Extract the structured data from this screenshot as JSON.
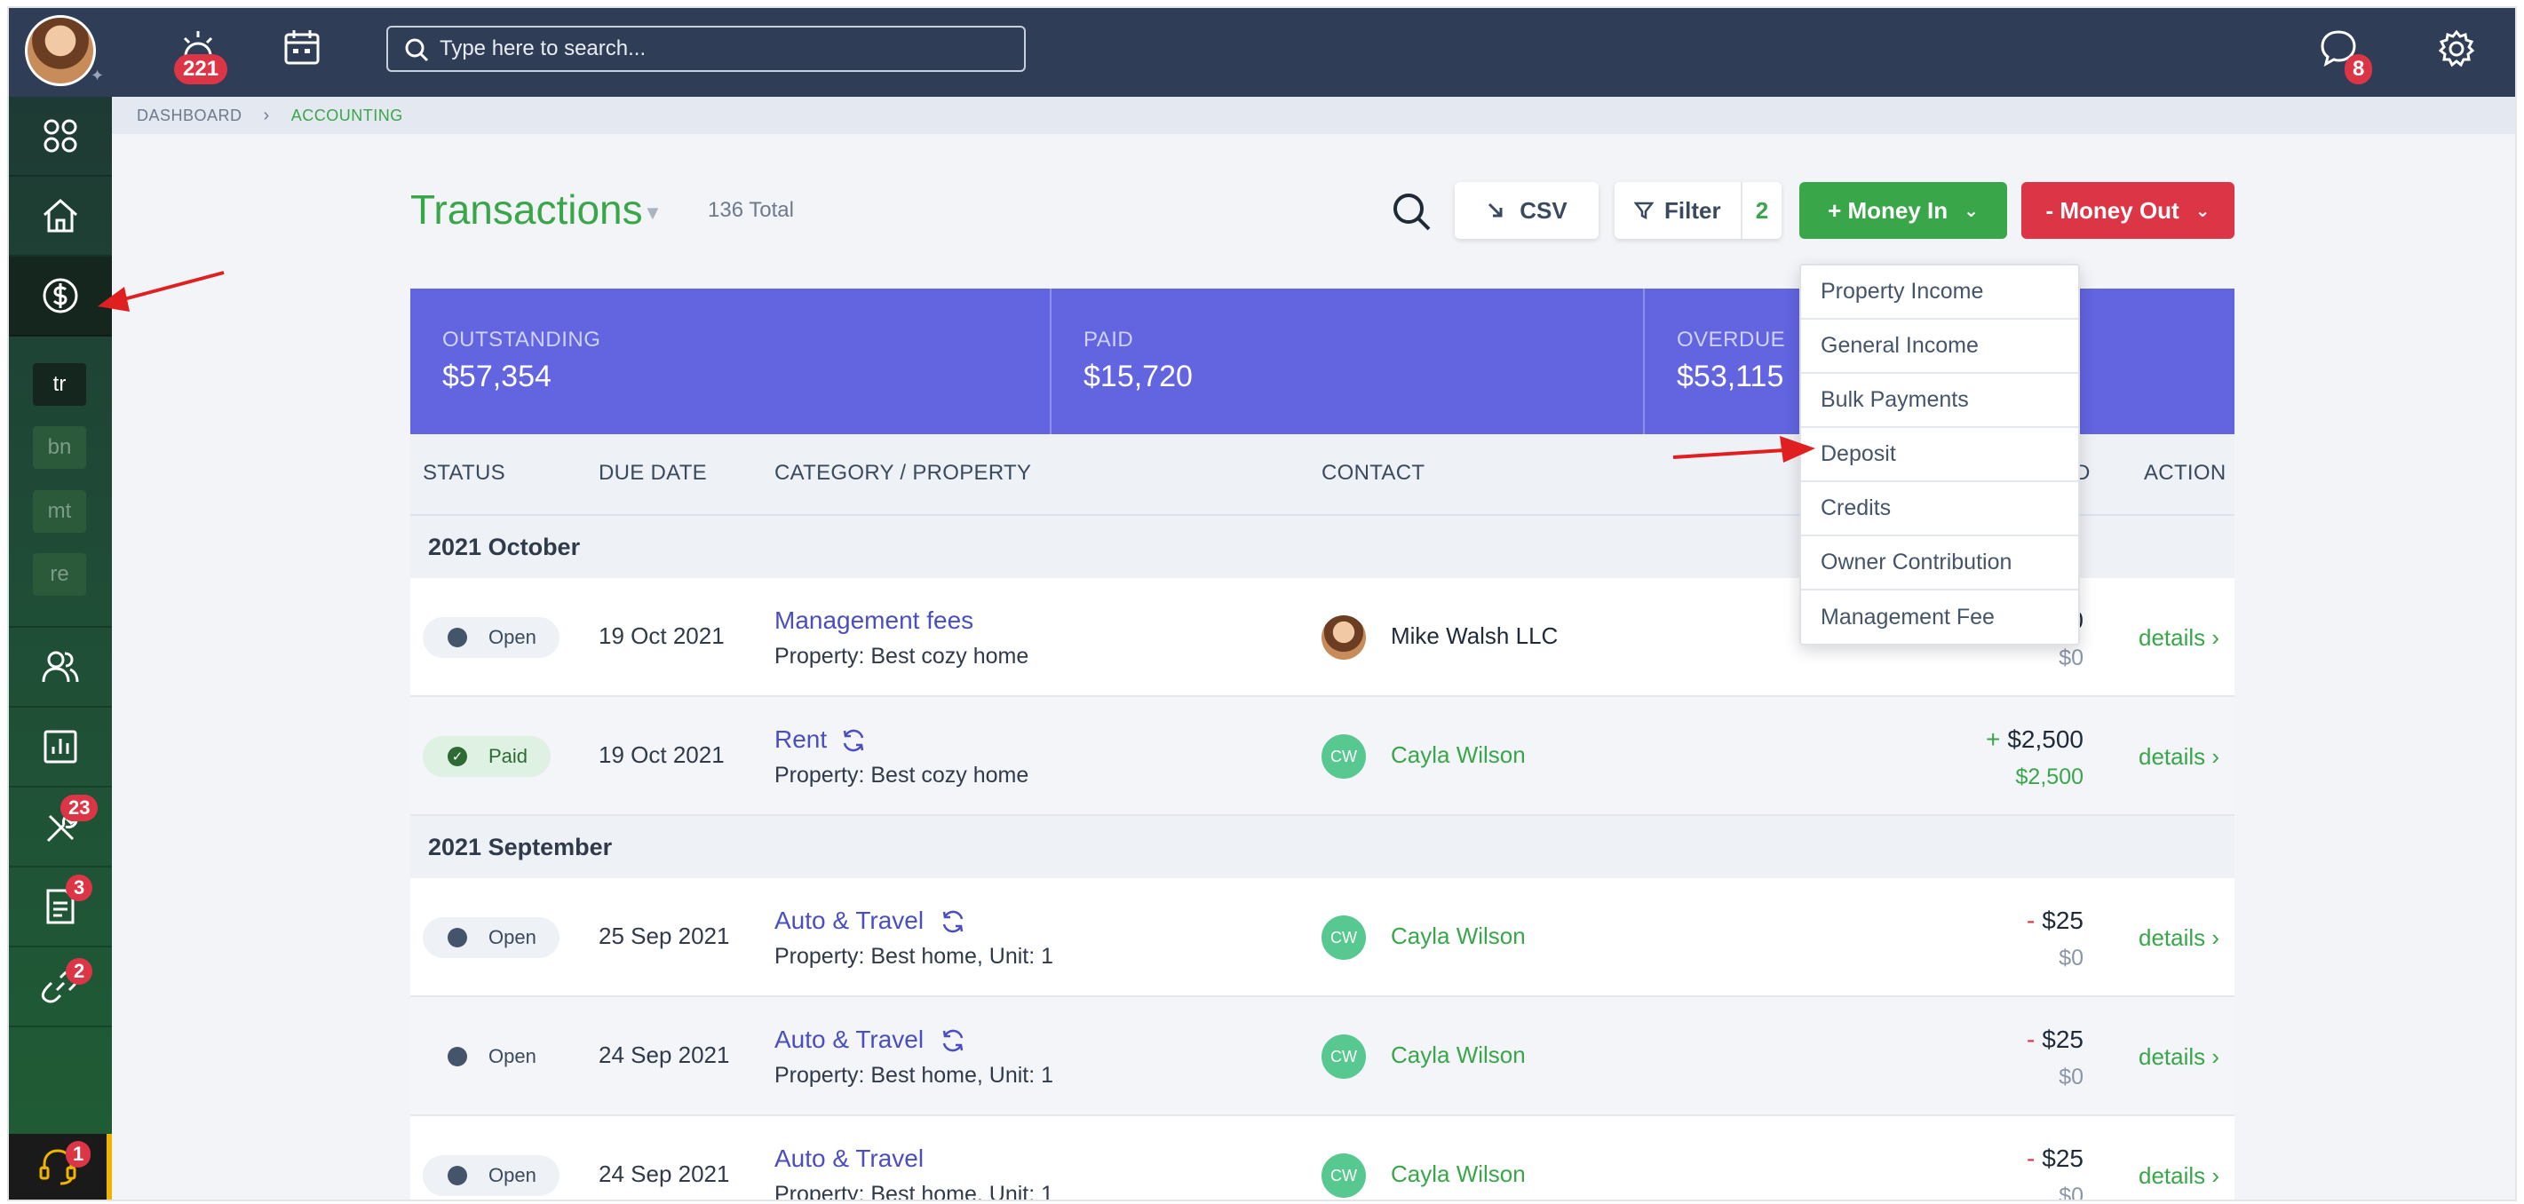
{
  "topbar": {
    "alert_badge": "221",
    "search_placeholder": "Type here to search...",
    "chat_badge": "8"
  },
  "sidebar": {
    "chips": [
      "tr",
      "bn",
      "mt",
      "re"
    ],
    "tools_badge": "23",
    "docs_badge": "3",
    "links_badge": "2",
    "support_badge": "1"
  },
  "breadcrumb": {
    "dashboard": "DASHBOARD",
    "accounting": "ACCOUNTING"
  },
  "header": {
    "title": "Transactions",
    "total": "136 Total",
    "csv_label": "CSV",
    "filter_label": "Filter",
    "filter_count": "2",
    "money_in_label": "+ Money In",
    "money_out_label": "- Money Out"
  },
  "summary": {
    "outstanding_label": "OUTSTANDING",
    "outstanding_value": "$57,354",
    "paid_label": "PAID",
    "paid_value": "$15,720",
    "overdue_label": "OVERDUE",
    "overdue_value": "$53,115"
  },
  "table": {
    "columns": {
      "status": "STATUS",
      "due_date": "DUE DATE",
      "category": "CATEGORY / PROPERTY",
      "contact": "CONTACT",
      "amount_partial": "D",
      "action": "ACTION"
    },
    "groups": [
      "2021 October",
      "2021 September"
    ],
    "rows": [
      {
        "status": "Open",
        "due": "19 Oct 2021",
        "category": "Management fees",
        "property": "Property: Best cozy home",
        "contact": "Mike Walsh LLC",
        "initials": "",
        "sign": "",
        "amount": "0",
        "sub": "$0",
        "action": "details"
      },
      {
        "status": "Paid",
        "due": "19 Oct 2021",
        "category": "Rent",
        "property": "Property: Best cozy home",
        "contact": "Cayla Wilson",
        "initials": "CW",
        "sign": "+",
        "amount": "$2,500",
        "sub": "$2,500",
        "action": "details"
      },
      {
        "status": "Open",
        "due": "25 Sep 2021",
        "category": "Auto & Travel",
        "property": "Property: Best home, Unit: 1",
        "contact": "Cayla Wilson",
        "initials": "CW",
        "sign": "-",
        "amount": "$25",
        "sub": "$0",
        "action": "details"
      },
      {
        "status": "Open",
        "due": "24 Sep 2021",
        "category": "Auto & Travel",
        "property": "Property: Best home, Unit: 1",
        "contact": "Cayla Wilson",
        "initials": "CW",
        "sign": "-",
        "amount": "$25",
        "sub": "$0",
        "action": "details"
      },
      {
        "status": "Open",
        "due": "24 Sep 2021",
        "category": "Auto & Travel",
        "property": "Property: Best home, Unit: 1",
        "contact": "Cayla Wilson",
        "initials": "CW",
        "sign": "-",
        "amount": "$25",
        "sub": "$0",
        "action": "details"
      }
    ]
  },
  "money_in_menu": [
    "Property Income",
    "General Income",
    "Bulk Payments",
    "Deposit",
    "Credits",
    "Owner Contribution",
    "Management Fee"
  ],
  "colors": {
    "brand_green": "#3aa64a",
    "danger_red": "#dc3545",
    "topbar": "#2f3e56",
    "summary_band": "#6264e0",
    "link_purple": "#4a4fc0"
  }
}
